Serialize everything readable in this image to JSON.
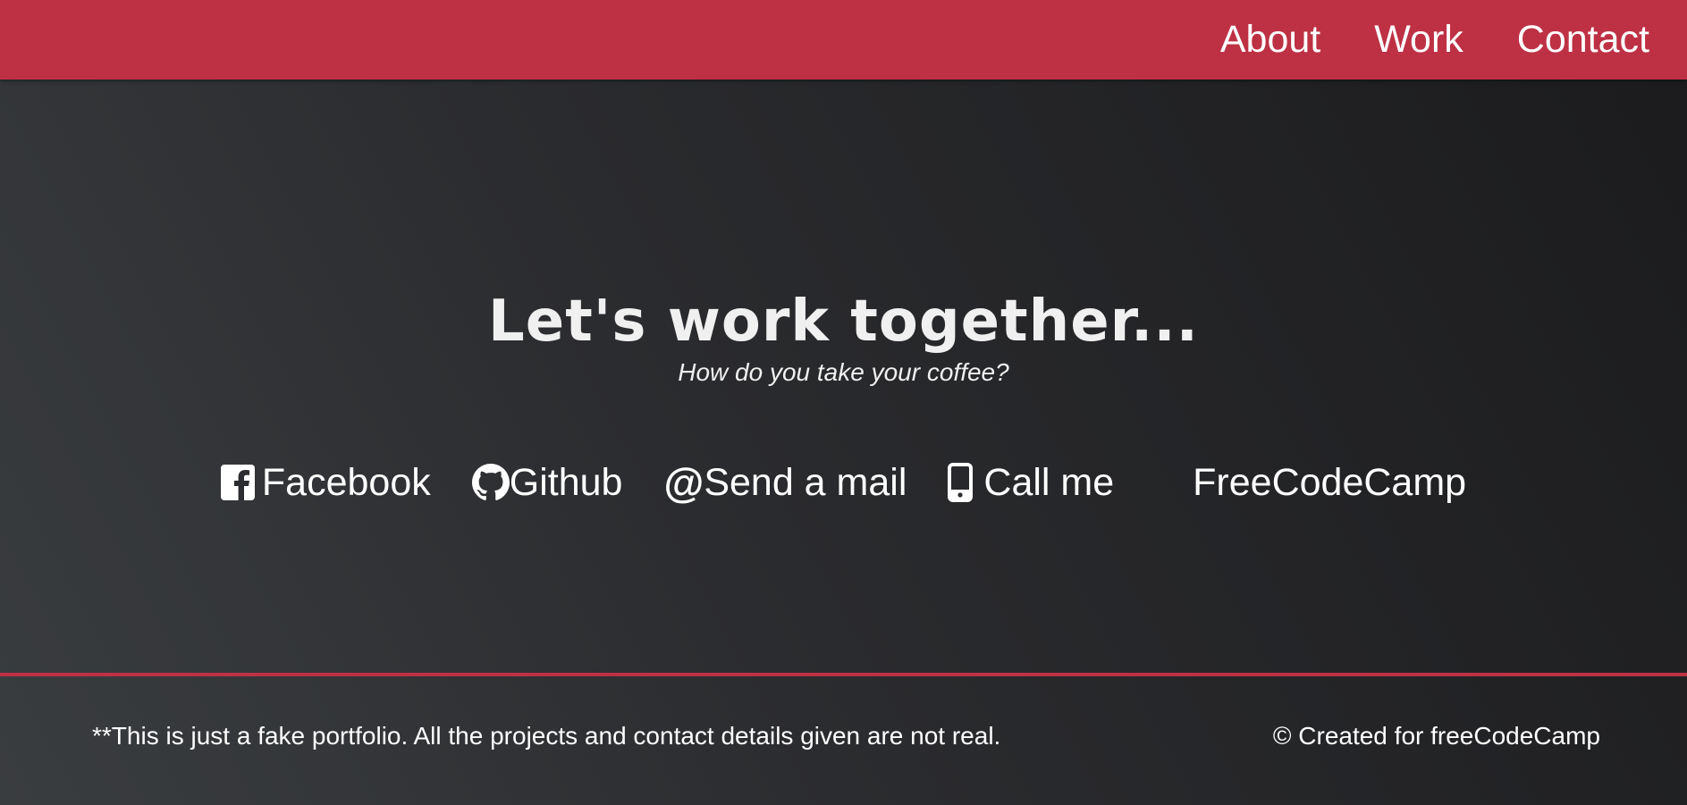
{
  "nav": {
    "items": [
      {
        "label": "About"
      },
      {
        "label": "Work"
      },
      {
        "label": "Contact"
      }
    ]
  },
  "contact": {
    "title": "Let's work together...",
    "subtitle": "How do you take your coffee?",
    "links": [
      {
        "label": "Facebook",
        "icon": "facebook-icon"
      },
      {
        "label": "Github",
        "icon": "github-icon"
      },
      {
        "label": "Send a mail",
        "icon": "at-icon"
      },
      {
        "label": "Call me",
        "icon": "mobile-phone-icon"
      },
      {
        "label": "FreeCodeCamp",
        "icon": "freecodecamp-icon"
      }
    ]
  },
  "footer": {
    "disclaimer": "**This is just a fake portfolio. All the projects and contact details given are not real.",
    "credit": "© Created for freeCodeCamp"
  },
  "colors": {
    "accent": "#be3144",
    "background_dark": "#1b1b1d",
    "background_light": "#3a3d40",
    "text": "#ffffff"
  }
}
